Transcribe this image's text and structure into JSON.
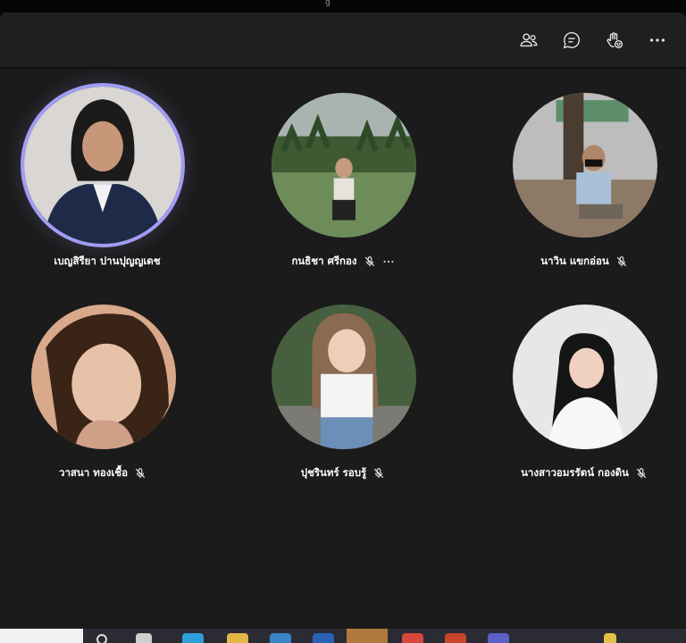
{
  "window": {
    "title_fragment": "g"
  },
  "toolbar": {
    "icons": [
      "people-icon",
      "chat-icon",
      "raise-hand-icon",
      "more-options-icon"
    ]
  },
  "participants": [
    {
      "name": "เบญสิรียา ปานปุญญเดช",
      "speaking": true,
      "muted": false,
      "has_more": false,
      "avatar_bg": "#d9d6d3"
    },
    {
      "name": "กนธิชา ศรีกอง",
      "speaking": false,
      "muted": true,
      "has_more": true,
      "avatar_bg": "#6d8c5a"
    },
    {
      "name": "นาวิน แขกอ่อน",
      "speaking": false,
      "muted": true,
      "has_more": false,
      "avatar_bg": "#bdbdbd"
    },
    {
      "name": "วาสนา ทองเชื้อ",
      "speaking": false,
      "muted": true,
      "has_more": false,
      "avatar_bg": "#d8a98a"
    },
    {
      "name": "ปุชรินทร์ รอบรู้",
      "speaking": false,
      "muted": true,
      "has_more": false,
      "avatar_bg": "#46603f"
    },
    {
      "name": "นางสาวอมรรัตน์ กองดิน",
      "speaking": false,
      "muted": true,
      "has_more": false,
      "avatar_bg": "#e8e7e5"
    }
  ],
  "colors": {
    "speaking_ring": "#a19df5",
    "stage_bg": "#1b1b1b",
    "toolbar_bg": "#1f1f1f"
  }
}
